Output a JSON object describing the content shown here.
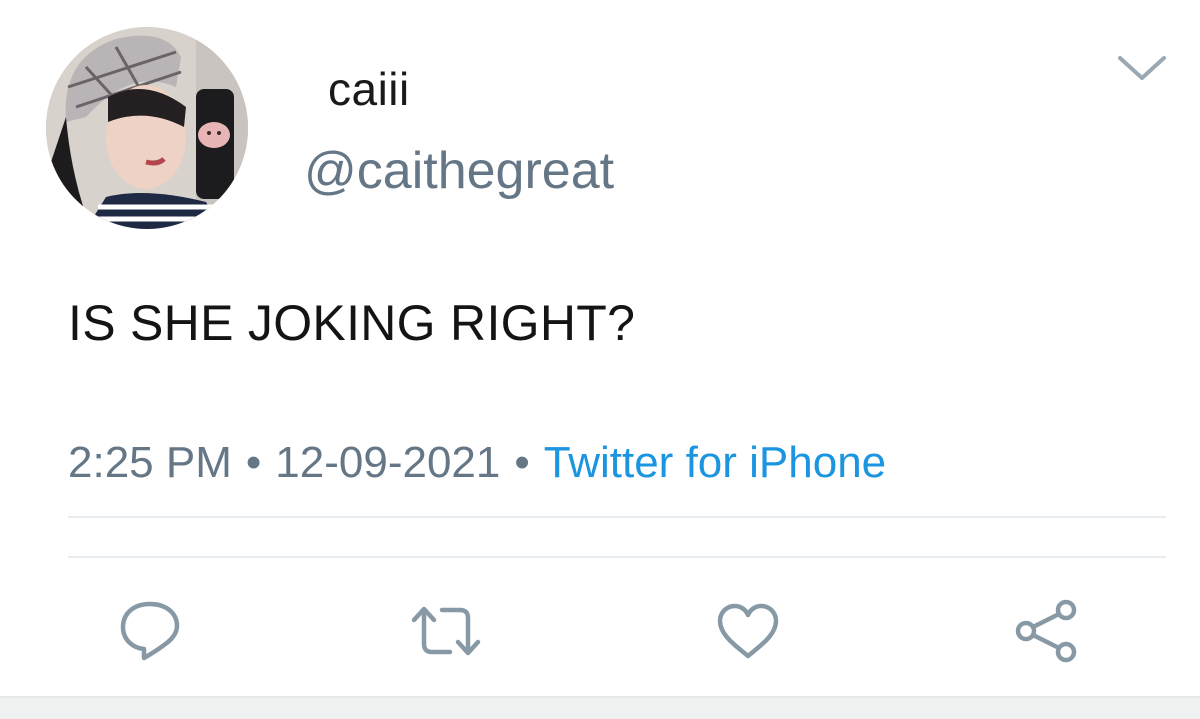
{
  "user": {
    "display_name": "caiii",
    "handle": "@caithegreat"
  },
  "tweet": {
    "text": "IS SHE JOKING RIGHT?",
    "time": "2:25 PM",
    "date": "12-09-2021",
    "separator": "•",
    "source": "Twitter for iPhone"
  },
  "actions": [
    {
      "name": "reply",
      "icon": "reply-icon"
    },
    {
      "name": "retweet",
      "icon": "retweet-icon"
    },
    {
      "name": "like",
      "icon": "heart-icon"
    },
    {
      "name": "share",
      "icon": "share-icon"
    }
  ],
  "colors": {
    "text": "#141414",
    "secondary": "#657786",
    "link": "#1b95e0",
    "icon": "#8899a6",
    "divider": "#e6ecf0"
  }
}
